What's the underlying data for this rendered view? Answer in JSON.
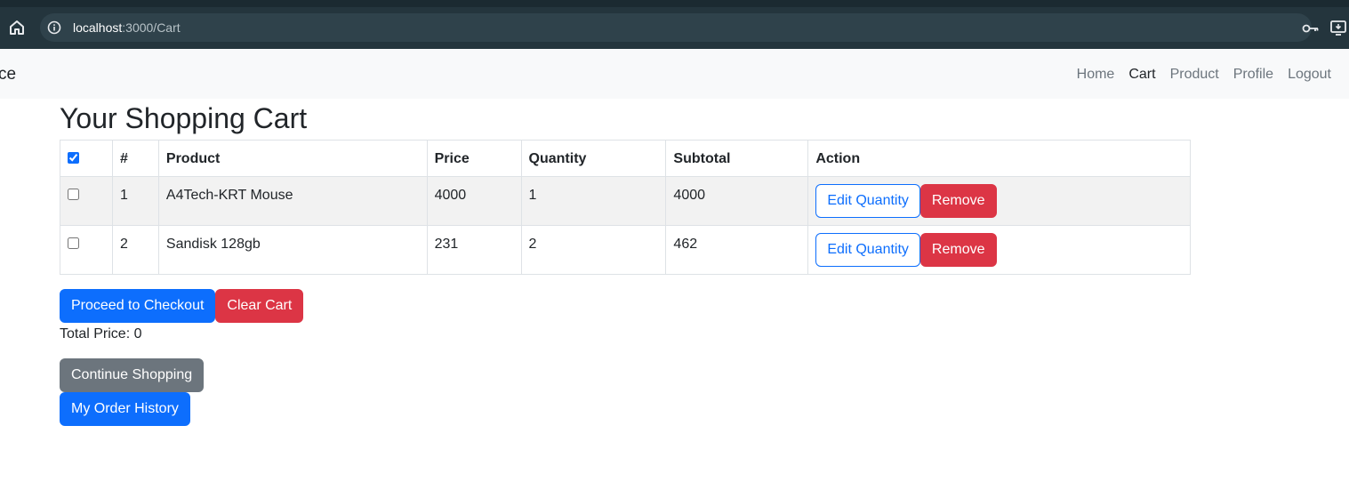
{
  "browser": {
    "url_host": "localhost",
    "url_path": ":3000/Cart"
  },
  "navbar": {
    "brand": "ce",
    "links": [
      {
        "label": "Home",
        "active": false
      },
      {
        "label": "Cart",
        "active": true
      },
      {
        "label": "Product",
        "active": false
      },
      {
        "label": "Profile",
        "active": false
      },
      {
        "label": "Logout",
        "active": false
      }
    ]
  },
  "page": {
    "title": "Your Shopping Cart"
  },
  "table": {
    "headers": {
      "select_all_checked": true,
      "number": "#",
      "product": "Product",
      "price": "Price",
      "quantity": "Quantity",
      "subtotal": "Subtotal",
      "action": "Action"
    },
    "rows": [
      {
        "checked": false,
        "number": "1",
        "product": "A4Tech-KRT Mouse",
        "price": "4000",
        "quantity": "1",
        "subtotal": "4000"
      },
      {
        "checked": false,
        "number": "2",
        "product": "Sandisk 128gb",
        "price": "231",
        "quantity": "2",
        "subtotal": "462"
      }
    ],
    "edit_label": "Edit Quantity",
    "remove_label": "Remove"
  },
  "actions": {
    "checkout_label": "Proceed to Checkout",
    "clear_label": "Clear Cart",
    "total_text": "Total Price: 0",
    "continue_label": "Continue Shopping",
    "history_label": "My Order History"
  },
  "colors": {
    "primary": "#0d6efd",
    "danger": "#dc3545",
    "secondary": "#6c757d",
    "navbar_bg": "#f8f9fa",
    "chrome_bg": "#24353d"
  },
  "icons": [
    "home-icon",
    "info-icon",
    "key-icon",
    "install-app-icon"
  ]
}
